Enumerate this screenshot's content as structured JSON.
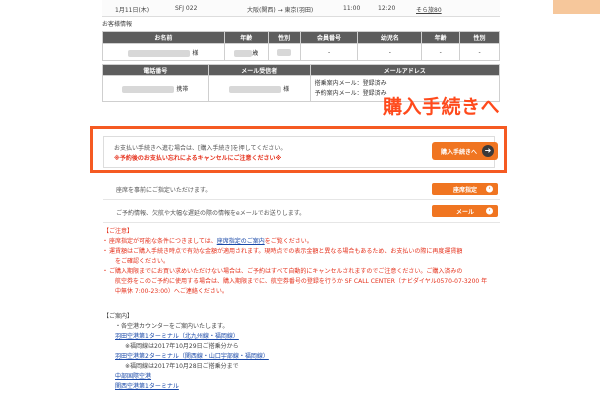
{
  "flight": {
    "date": "1月11日(木)",
    "flight_no": "SFJ 022",
    "route": "大阪(関西) → 東京(羽田)",
    "dep": "11:00",
    "arr": "12:20",
    "fare_link": "そら旅80"
  },
  "customer": {
    "section_title": "お客様情報",
    "headers": [
      "お名前",
      "年齢",
      "性別",
      "会員番号",
      "幼児名",
      "年齢",
      "性別"
    ],
    "row": {
      "name_suffix": "様",
      "age_suffix": "歳",
      "member": "-",
      "infant": "-",
      "infant_age": "-",
      "infant_gender": "-"
    }
  },
  "contact": {
    "headers": [
      "電話番号",
      "メール受信者",
      "メールアドレス"
    ],
    "phone_type": "携帯",
    "recipient_suffix": "様",
    "email_lines": [
      "搭乗案内メール：登録済み",
      "予約案内メール：登録済み"
    ]
  },
  "callout": "購入手続きへ",
  "notice": {
    "line1": "お支払い手続きへ進む場合は、[購入手続き]を押してください。",
    "line2": "※予約後のお支払い忘れによるキャンセルにご注意ください※",
    "button": "購入手続きへ"
  },
  "options": [
    {
      "text": "座席を事前にご指定いただけます。",
      "button": "座席指定"
    },
    {
      "text": "ご予約情報、欠航や大幅な遅延の際の情報をeメールでお送りします。",
      "button": "メール"
    }
  ],
  "notes": {
    "head": "【ご注意】",
    "item1_prefix": "座席指定が可能な条件につきましては、",
    "item1_link": "座席指定のご案内",
    "item1_suffix": "をご覧ください。",
    "item2a": "運賃額はご購入手続き時点で有効な金額が適用されます。現時点での表示金額と異なる場合もあるため、お支払いの際に再度運賃額",
    "item2b": "をご確認ください。",
    "item3a": "ご購入期限までにお買い求めいただけない場合は、ご予約はすべて自動的にキャンセルされますのでご注意ください。ご購入済みの",
    "item3b": "航空券をこのご予約に使用する場合は、購入期限までに、航空券番号の登録を行うか SF CALL CENTER（ナビダイヤル0570-07-3200 年",
    "item3c": "中無休 7:00-23:00）へご連絡ください。"
  },
  "guide": {
    "head": "【ご案内】",
    "item": "・各空港カウンターをご案内いたします。",
    "links": [
      {
        "link": "羽田空港第1ターミナル（北九州線・福岡線）",
        "note": "※福岡線は2017年10月29日ご搭乗分から"
      },
      {
        "link": "羽田空港第2ターミナル（関西線・山口宇部線・福岡線）",
        "note": "※福岡線は2017年10月28日ご搭乗分まで"
      },
      {
        "link": "中部国際空港",
        "note": ""
      },
      {
        "link": "関西空港第1ターミナル",
        "note": ""
      }
    ]
  }
}
